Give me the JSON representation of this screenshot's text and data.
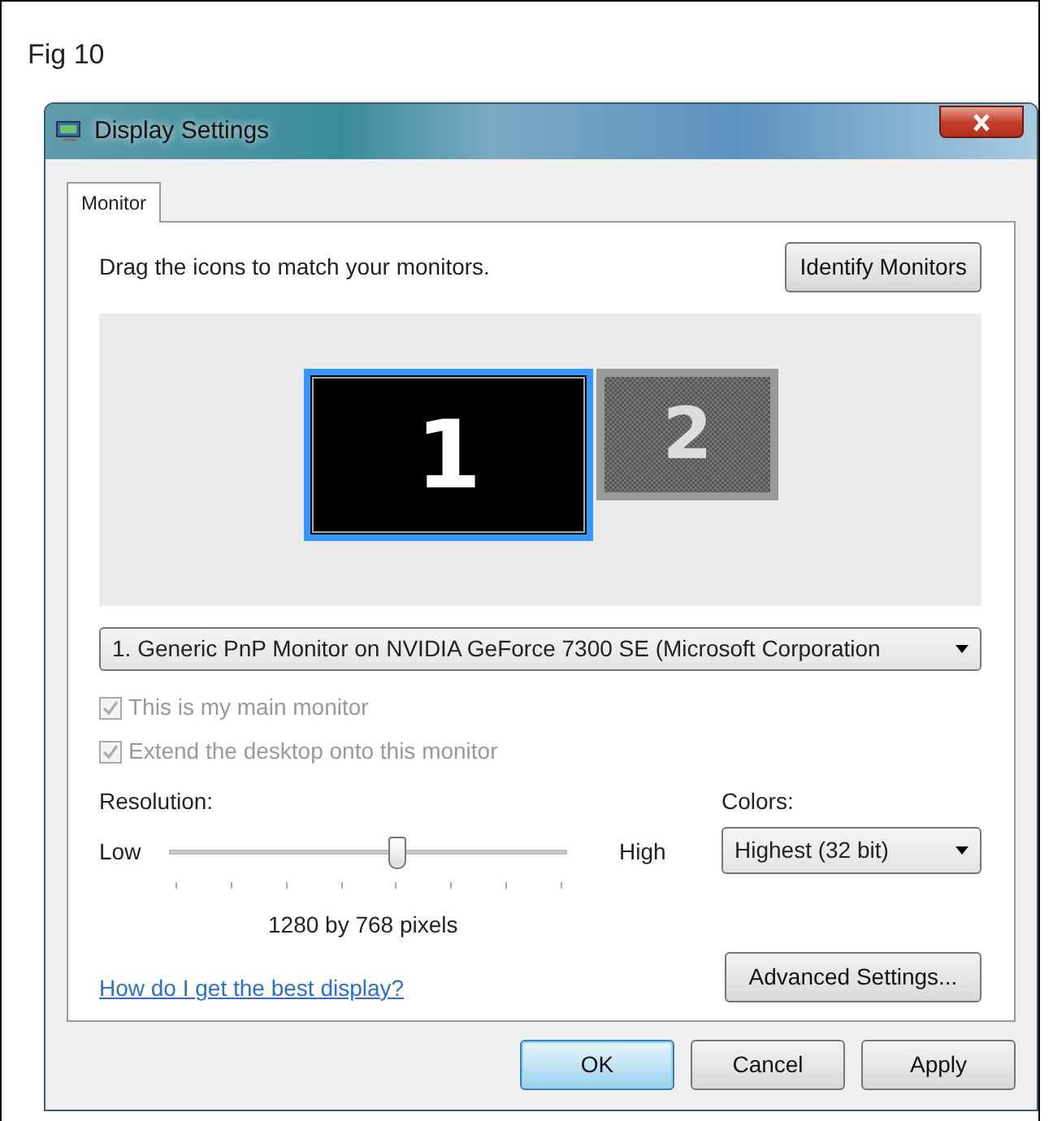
{
  "figure_label": "Fig 10",
  "window": {
    "title": "Display Settings"
  },
  "tabs": [
    {
      "label": "Monitor",
      "selected": true
    }
  ],
  "instruction": "Drag the icons to match your monitors.",
  "identify_button": "Identify Monitors",
  "monitors": [
    {
      "label": "1",
      "selected": true
    },
    {
      "label": "2",
      "selected": false
    }
  ],
  "display_select": {
    "value": "1. Generic PnP Monitor on NVIDIA GeForce 7300 SE (Microsoft Corporation"
  },
  "checkboxes": [
    {
      "label": "This is my main monitor",
      "checked": true,
      "disabled": true
    },
    {
      "label": "Extend the desktop onto this monitor",
      "checked": true,
      "disabled": true
    }
  ],
  "resolution": {
    "label": "Resolution:",
    "low": "Low",
    "high": "High",
    "level": 0.57,
    "reading": "1280 by 768 pixels"
  },
  "colors": {
    "label": "Colors:",
    "value": "Highest (32 bit)"
  },
  "help_link": "How do I get the best display?",
  "advanced_button": "Advanced Settings...",
  "buttons": [
    {
      "label": "OK",
      "default": true
    },
    {
      "label": "Cancel",
      "default": false
    },
    {
      "label": "Apply",
      "default": false
    }
  ]
}
